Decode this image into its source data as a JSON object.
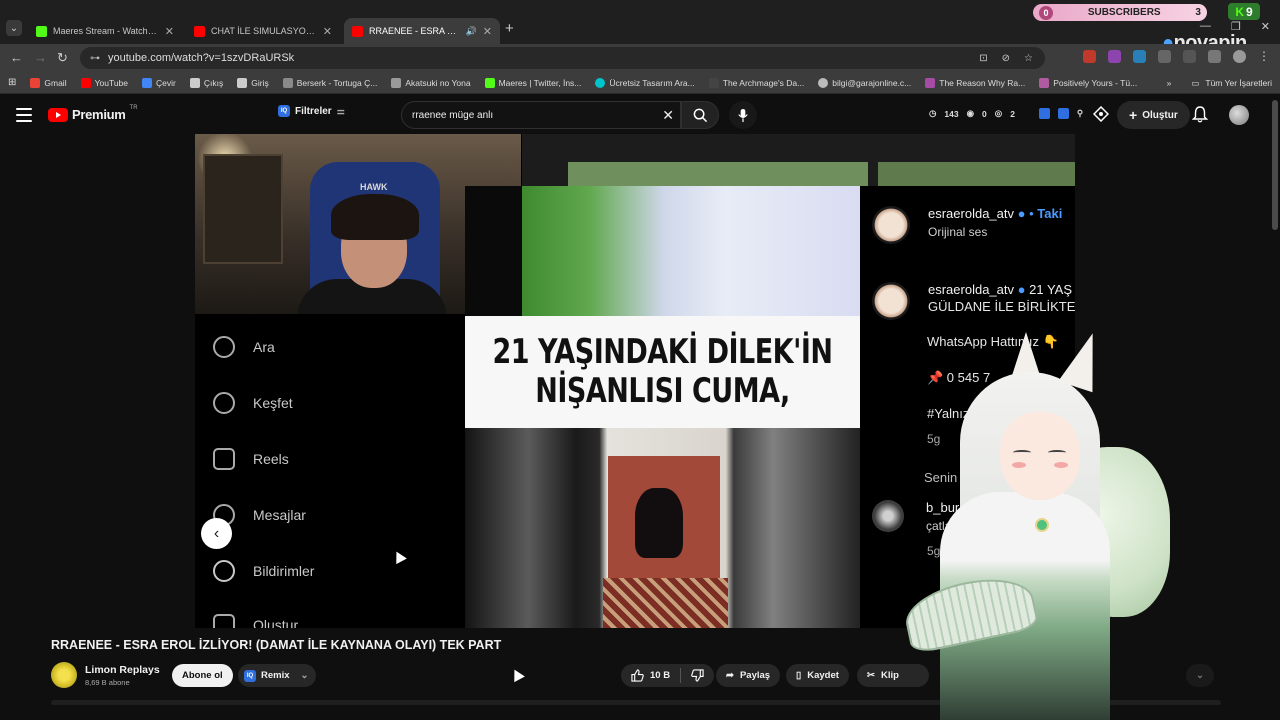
{
  "browser": {
    "tabs": [
      {
        "title": "Maeres Stream - Watch Live on",
        "active": false
      },
      {
        "title": "CHAT İLE SIMULASYON KEYFİ |",
        "active": false
      },
      {
        "title": "RRAENEE - ESRA EROL İZLİY",
        "active": true
      }
    ],
    "url": "youtube.com/watch?v=1szvDRaURSk",
    "bookmarks": [
      "Gmail",
      "YouTube",
      "Çevir",
      "Çıkış",
      "Giriş",
      "Berserk - Tortuga Ç...",
      "Akatsuki no Yona",
      "Maeres | Twitter, İns...",
      "Ücretsiz Tasarım Ara...",
      "The Archmage's Da...",
      "bilgi@garajonline.c...",
      "The Reason Why Ra...",
      "Positively Yours - Tü..."
    ],
    "bookmarks_more": "»",
    "all_bookmarks": "Tüm Yer İşaretleri"
  },
  "overlay": {
    "subs_left": "0",
    "subs_label": "SUBSCRIBERS",
    "subs_right": "3",
    "kick_count": "9",
    "brand": "novapin"
  },
  "youtube": {
    "logo_text": "Premium",
    "region": "TR",
    "filters_label": "Filtreler",
    "filters_badge": "IQ",
    "search_value": "rraenee müge anlı",
    "stats": {
      "views": "143",
      "a": "0",
      "b": "2"
    },
    "create_label": "Oluştur"
  },
  "video": {
    "chair_logo": "HAWK",
    "caption_line1": "21 YAŞINDAKİ DİLEK'İN",
    "caption_line2": "NİŞANLISI CUMA,",
    "ig_menu": [
      "Ara",
      "Keşfet",
      "Reels",
      "Mesajlar",
      "Bildirimler",
      "Oluştur"
    ],
    "comments": {
      "author": "esraerolda_atv",
      "follow": "Taki",
      "audio": "Orijinal ses",
      "post_name": "esraerolda_atv",
      "post_suffix": "21 YAŞ",
      "post_line": "GÜLDANE İLE BİRLİKTE K",
      "whatsapp": "WhatsApp Hattımız 👇",
      "phone": "📌 0 545 7",
      "hashtag": "#YalnızDeğil",
      "time1": "5g",
      "for_you": "Senin için",
      "c2_name": "b_bur_cu",
      "c2_text": "çatlaç",
      "time2": "5g"
    }
  },
  "below_video": {
    "title": "RRAENEE - ESRA EROL İZLİYOR! (DAMAT İLE KAYNANA OLAYI) TEK PART",
    "channel": "Limon Replays",
    "subscribers": "8,69 B abone",
    "subscribe_label": "Abone ol",
    "remix_label": "Remix",
    "likes": "10 B",
    "share_label": "Paylaş",
    "save_label": "Kaydet",
    "clip_label": "Klip"
  },
  "colors": {
    "yt_red": "#ff0000",
    "accent_blue": "#2f6fe0",
    "ig_blue": "#4c9bff"
  }
}
